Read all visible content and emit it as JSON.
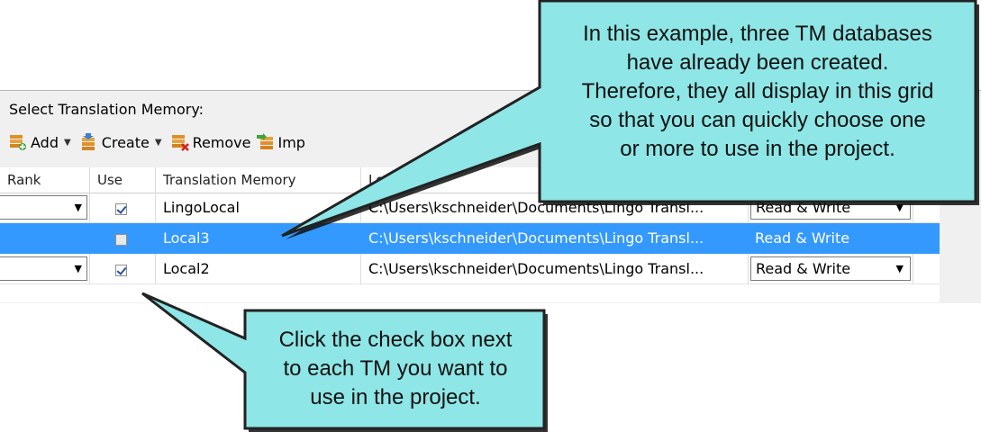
{
  "panel": {
    "section_label": "Select Translation Memory:"
  },
  "toolbar": {
    "add_label": "Add",
    "create_label": "Create",
    "remove_label": "Remove",
    "import_label": "Imp"
  },
  "grid": {
    "columns": [
      "Rank",
      "Use",
      "Translation Memory",
      "Location"
    ],
    "rows": [
      {
        "name": "LingoLocal",
        "location": "C:\\Users\\kschneider\\Documents\\Lingo Transl...",
        "permission": "Read & Write",
        "use": true,
        "selected": false
      },
      {
        "name": "Local3",
        "location": "C:\\Users\\kschneider\\Documents\\Lingo Transl...",
        "permission": "Read & Write",
        "use": false,
        "selected": true
      },
      {
        "name": "Local2",
        "location": "C:\\Users\\kschneider\\Documents\\Lingo Transl...",
        "permission": "Read & Write",
        "use": true,
        "selected": false
      }
    ]
  },
  "callouts": {
    "top": [
      "In this example, three TM databases",
      "have already been created.",
      "Therefore, they all display in this grid",
      "so that you can quickly choose one",
      "or more to use in the project."
    ],
    "bottom": [
      "Click the check box next",
      "to each TM you want to",
      "use in the project."
    ]
  },
  "colors": {
    "selection": "#3399ff",
    "callout_fill": "#8ee6e6",
    "callout_border": "#222222"
  }
}
